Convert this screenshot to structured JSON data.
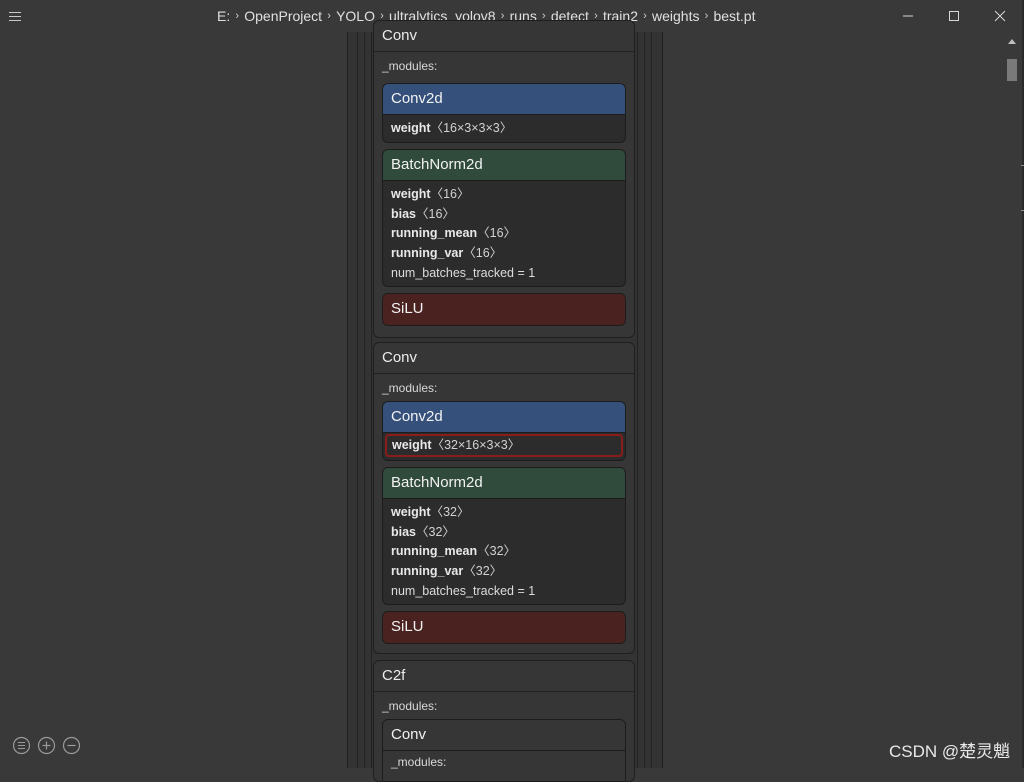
{
  "titlebar": {
    "breadcrumb": [
      "E:",
      "OpenProject",
      "YOLO",
      "ultralytics_yolov8",
      "runs",
      "detect",
      "train2",
      "weights",
      "best.pt"
    ],
    "sep": "›"
  },
  "nodes": [
    {
      "title": "Conv",
      "modules_label": "_modules:",
      "conv2d": {
        "title": "Conv2d",
        "attrs": [
          {
            "name": "weight",
            "value": "〈16×3×3×3〉"
          }
        ]
      },
      "batchnorm": {
        "title": "BatchNorm2d",
        "attrs": [
          {
            "name": "weight",
            "value": "〈16〉"
          },
          {
            "name": "bias",
            "value": "〈16〉"
          },
          {
            "name": "running_mean",
            "value": "〈16〉"
          },
          {
            "name": "running_var",
            "value": "〈16〉"
          }
        ],
        "plain": "num_batches_tracked = 1"
      },
      "silu": {
        "title": "SiLU"
      }
    },
    {
      "title": "Conv",
      "modules_label": "_modules:",
      "conv2d": {
        "title": "Conv2d",
        "attrs": [
          {
            "name": "weight",
            "value": "〈32×16×3×3〉"
          }
        ]
      },
      "batchnorm": {
        "title": "BatchNorm2d",
        "attrs": [
          {
            "name": "weight",
            "value": "〈32〉"
          },
          {
            "name": "bias",
            "value": "〈32〉"
          },
          {
            "name": "running_mean",
            "value": "〈32〉"
          },
          {
            "name": "running_var",
            "value": "〈32〉"
          }
        ],
        "plain": "num_batches_tracked = 1"
      },
      "silu": {
        "title": "SiLU"
      }
    },
    {
      "title": "C2f",
      "modules_label": "_modules:",
      "child": {
        "title": "Conv",
        "modules_label": "_modules:"
      }
    }
  ],
  "watermark": "CSDN @楚灵魈",
  "colors": {
    "background": "#393939",
    "conv2d": "#35507a",
    "batchnorm": "#304a3b",
    "silu": "#4a2320",
    "highlight": "#8a1c1c"
  }
}
